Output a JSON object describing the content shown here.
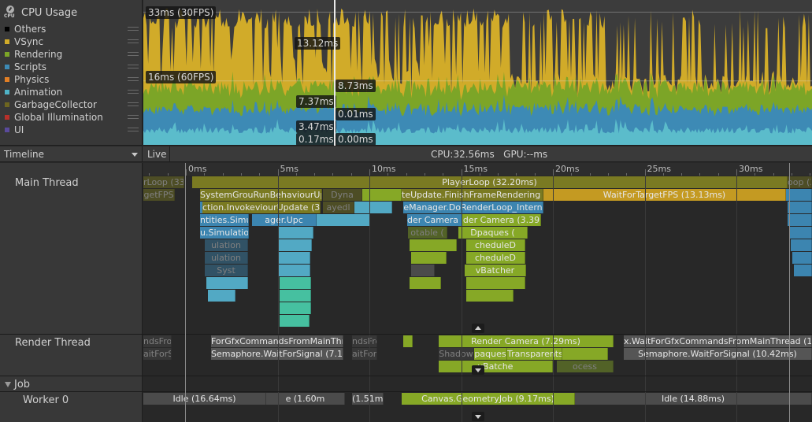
{
  "module": {
    "title": "CPU Usage",
    "icon": "cpu-gauge-icon",
    "icon_text": "CPU",
    "legend": [
      {
        "label": "Others",
        "color": "#000000"
      },
      {
        "label": "VSync",
        "color": "#d1ab29"
      },
      {
        "label": "Rendering",
        "color": "#7ca527"
      },
      {
        "label": "Scripts",
        "color": "#3d8ab5"
      },
      {
        "label": "Physics",
        "color": "#e27f25"
      },
      {
        "label": "Animation",
        "color": "#4fb3c7"
      },
      {
        "label": "GarbageCollector",
        "color": "#6e6620"
      },
      {
        "label": "Global Illumination",
        "color": "#b8302a"
      },
      {
        "label": "UI",
        "color": "#5a4a9c"
      }
    ]
  },
  "chart_data": {
    "type": "area",
    "title": "CPU Usage",
    "stacked": true,
    "series_order_bottom_to_top": [
      "Animation",
      "Scripts",
      "Rendering",
      "VSync",
      "Others"
    ],
    "reference_lines": [
      {
        "label": "33ms (30FPS)",
        "value_ms": 33
      },
      {
        "label": "16ms (60FPS)",
        "value_ms": 16
      }
    ],
    "ylim_ms": [
      0,
      36
    ],
    "selected_frame_labels": {
      "left": [
        "13.12ms",
        "7.37ms",
        "3.47ms",
        "0.17ms"
      ],
      "right": [
        "8.73ms",
        "0.01ms",
        "0.00ms"
      ]
    },
    "selected_frame_values_ms": {
      "VSync": 13.12,
      "Rendering": 8.73,
      "Scripts": 7.37,
      "Physics": 0.01,
      "Animation": 3.47,
      "GarbageCollector": 0.17,
      "UI": 0.0
    }
  },
  "timeline": {
    "view_mode": "Timeline",
    "live_label": "Live",
    "stats": "CPU:32.56ms   GPU:--ms",
    "ruler": [
      "0ms",
      "5ms",
      "10ms",
      "15ms",
      "20ms",
      "25ms",
      "30ms"
    ],
    "threads": {
      "main": "Main Thread",
      "render": "Render Thread",
      "job_group": "Job",
      "worker0": "Worker 0"
    },
    "main_bars": {
      "prev_playerloop": "rLoop (33.0",
      "prev_wait": "getFPS",
      "playerloop": "PlayerLoop (32.20ms)",
      "system_group": "SystemGrouRunBehaviourUpd",
      "dyna": "Dyna",
      "finish_frame": "teUpdate.FinishFrameRendering (7",
      "wait_target_fps": "WaitForTargetFPS (13.13ms)",
      "invoke_update": "ction.InvokeviourUpdate (3.5",
      "delayed": "ayedl",
      "render_loop": "eManager.DoRenderLoop_Intern",
      "entities_sim": "ntities.Simu",
      "manager_upd": "ager.Upc",
      "render_camera_a": "der Camera (2",
      "render_camera_b": "der Camera (3.39",
      "simulation": "u.Simulation",
      "table": "otable (",
      "opaques": "Dpaques (",
      "ulation1": "ulation",
      "ulation2": "ulation",
      "schedule1": "cheduleD",
      "schedule2": "cheduleD",
      "syst": "Syst",
      "batcher": "vBatcher",
      "next_loop": "oop (3"
    },
    "render_bars": {
      "prev_cmds": "ndsFrom",
      "prev_wait": "aitForS",
      "wait_gfx": "ForGfxCommandsFromMainThread",
      "semaphore1": "Semaphore.WaitForSignal (7.15ms)",
      "cmds2": "ndsFro",
      "wait2": "aitForS",
      "render_camera": "Render Camera (7.29ms)",
      "shadow": "Shadow",
      "opaques": "paques",
      "transparents": "Transparents (",
      "batcher": "yBatche",
      "ocess": "ocess",
      "wait_gfx2": "x.WaitForGfxCommandsFromMainThread (10.42m",
      "semaphore2": "Semaphore.WaitForSignal (10.42ms)"
    },
    "worker_bars": {
      "idle1": "Idle (16.64ms)",
      "idle2": "e (1.60m",
      "idle3": "(1.51m",
      "canvas_job": "Canvas.GeometryJob (9.17ms)",
      "idle4": "Idle (14.88ms)"
    }
  },
  "colors": {
    "vsync": "#d1ab29",
    "rendering": "#7ca527",
    "scripts": "#3d8ab5",
    "animation": "#5bbccb",
    "playerloop": "#7a7a2a",
    "idle": "#4a4a4a"
  }
}
